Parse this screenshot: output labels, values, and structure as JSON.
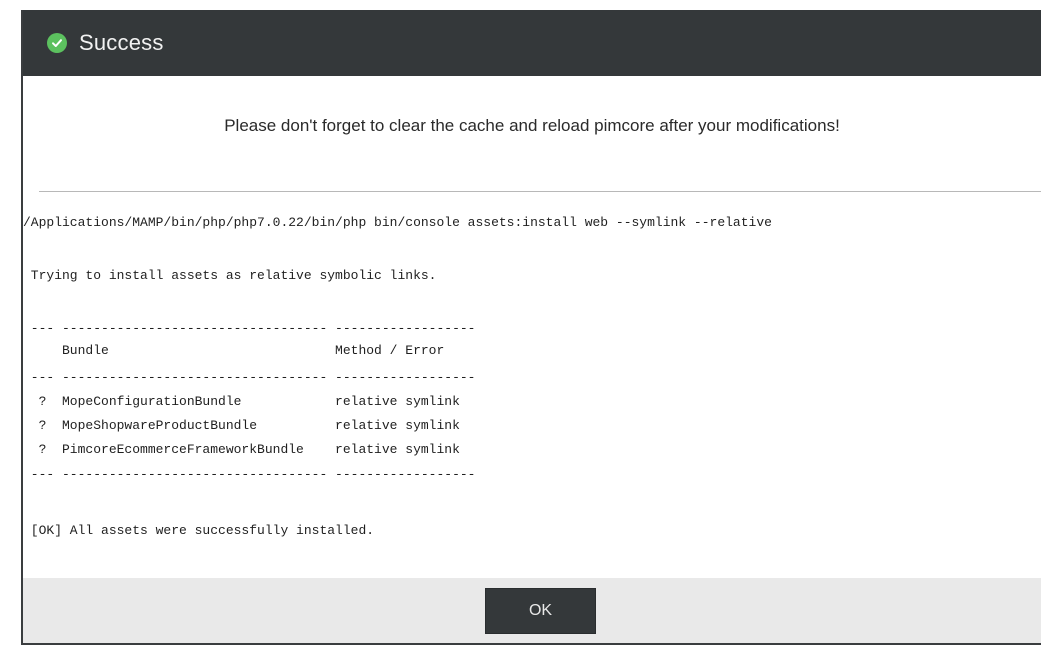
{
  "dialog": {
    "title": "Success",
    "icon": "check-circle-icon",
    "message": "Please don't forget to clear the cache and reload pimcore after your modifications!",
    "ok_label": "OK"
  },
  "console": {
    "command": "/Applications/MAMP/bin/php/php7.0.22/bin/php bin/console assets:install web --symlink --relative",
    "info": " Trying to install assets as relative symbolic links.",
    "table": {
      "rule": " --- ---------------------------------- ------------------",
      "header": "     Bundle                             Method / Error",
      "rows": [
        "  ?  MopeConfigurationBundle            relative symlink",
        "  ?  MopeShopwareProductBundle          relative symlink",
        "  ?  PimcoreEcommerceFrameworkBundle    relative symlink"
      ]
    },
    "result": " [OK] All assets were successfully installed."
  },
  "colors": {
    "header_bg": "#34383a",
    "success_green": "#5cc15f",
    "footer_bg": "#e9e9e9"
  }
}
